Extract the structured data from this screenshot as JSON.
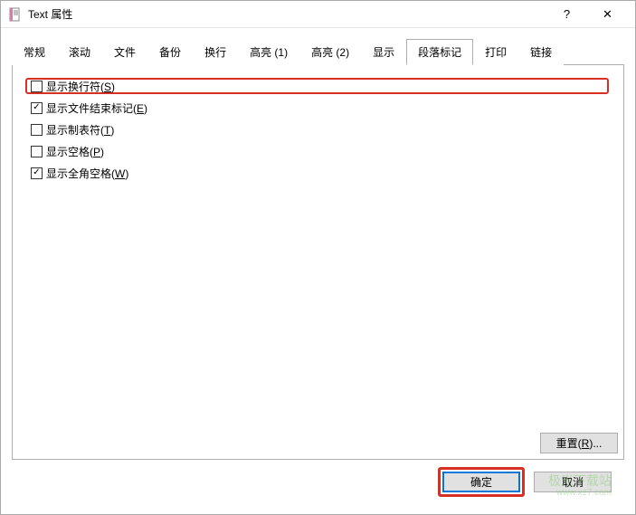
{
  "titlebar": {
    "title": "Text 属性",
    "help_symbol": "?",
    "close_symbol": "✕"
  },
  "tabs": {
    "t0": "常规",
    "t1": "滚动",
    "t2": "文件",
    "t3": "备份",
    "t4": "换行",
    "t5": "高亮 (1)",
    "t6": "高亮 (2)",
    "t7": "显示",
    "t8": "段落标记",
    "t9": "打印",
    "t10": "链接"
  },
  "options": {
    "show_line_break_label": "显示换行符(",
    "show_line_break_hotkey": "S",
    "show_line_break_close": ")",
    "show_eof_label": "显示文件结束标记(",
    "show_eof_hotkey": "E",
    "show_eof_close": ")",
    "show_tab_label": "显示制表符(",
    "show_tab_hotkey": "T",
    "show_tab_close": ")",
    "show_space_label": "显示空格(",
    "show_space_hotkey": "P",
    "show_space_close": ")",
    "show_fullwidth_space_label": "显示全角空格(",
    "show_fullwidth_space_hotkey": "W",
    "show_fullwidth_space_close": ")"
  },
  "buttons": {
    "reset": "重置(",
    "reset_hotkey": "R",
    "reset_close": ")...",
    "ok": "确定",
    "cancel": "取消"
  },
  "watermark": {
    "line1": "极光下载站",
    "line2": "www.xz7.com"
  }
}
